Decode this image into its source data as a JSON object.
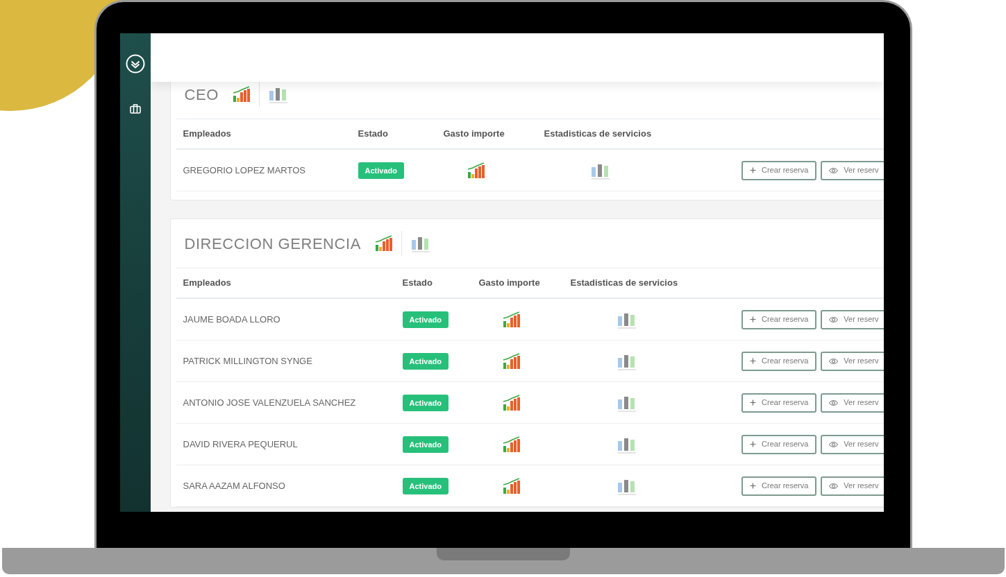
{
  "sections": [
    {
      "title": "CEO",
      "columns": [
        "Empleados",
        "Estado",
        "Gasto importe",
        "Estadisticas de servicios"
      ],
      "rows": [
        {
          "name": "GREGORIO LOPEZ MARTOS",
          "status": "Activado",
          "actions": [
            {
              "kind": "create",
              "label": "Crear reserva"
            },
            {
              "kind": "view",
              "label": "Ver reserv"
            }
          ]
        }
      ]
    },
    {
      "title": "DIRECCION GERENCIA",
      "columns": [
        "Empleados",
        "Estado",
        "Gasto importe",
        "Estadisticas de servicios"
      ],
      "rows": [
        {
          "name": "JAUME BOADA LLORO",
          "status": "Activado",
          "actions": [
            {
              "kind": "create",
              "label": "Crear reserva"
            },
            {
              "kind": "view",
              "label": "Ver reserv"
            }
          ]
        },
        {
          "name": "PATRICK MILLINGTON SYNGE",
          "status": "Activado",
          "actions": [
            {
              "kind": "create",
              "label": "Crear reserva"
            },
            {
              "kind": "view",
              "label": "Ver reserv"
            }
          ]
        },
        {
          "name": "ANTONIO JOSE VALENZUELA SANCHEZ",
          "status": "Activado",
          "actions": [
            {
              "kind": "create",
              "label": "Crear reserva"
            },
            {
              "kind": "view",
              "label": "Ver reserv"
            }
          ]
        },
        {
          "name": "DAVID RIVERA PEQUERUL",
          "status": "Activado",
          "actions": [
            {
              "kind": "create",
              "label": "Crear reserva"
            },
            {
              "kind": "view",
              "label": "Ver reserv"
            }
          ]
        },
        {
          "name": "SARA AAZAM ALFONSO",
          "status": "Activado",
          "actions": [
            {
              "kind": "create",
              "label": "Crear reserva"
            },
            {
              "kind": "view",
              "label": "Ver reserv"
            }
          ]
        }
      ]
    }
  ]
}
